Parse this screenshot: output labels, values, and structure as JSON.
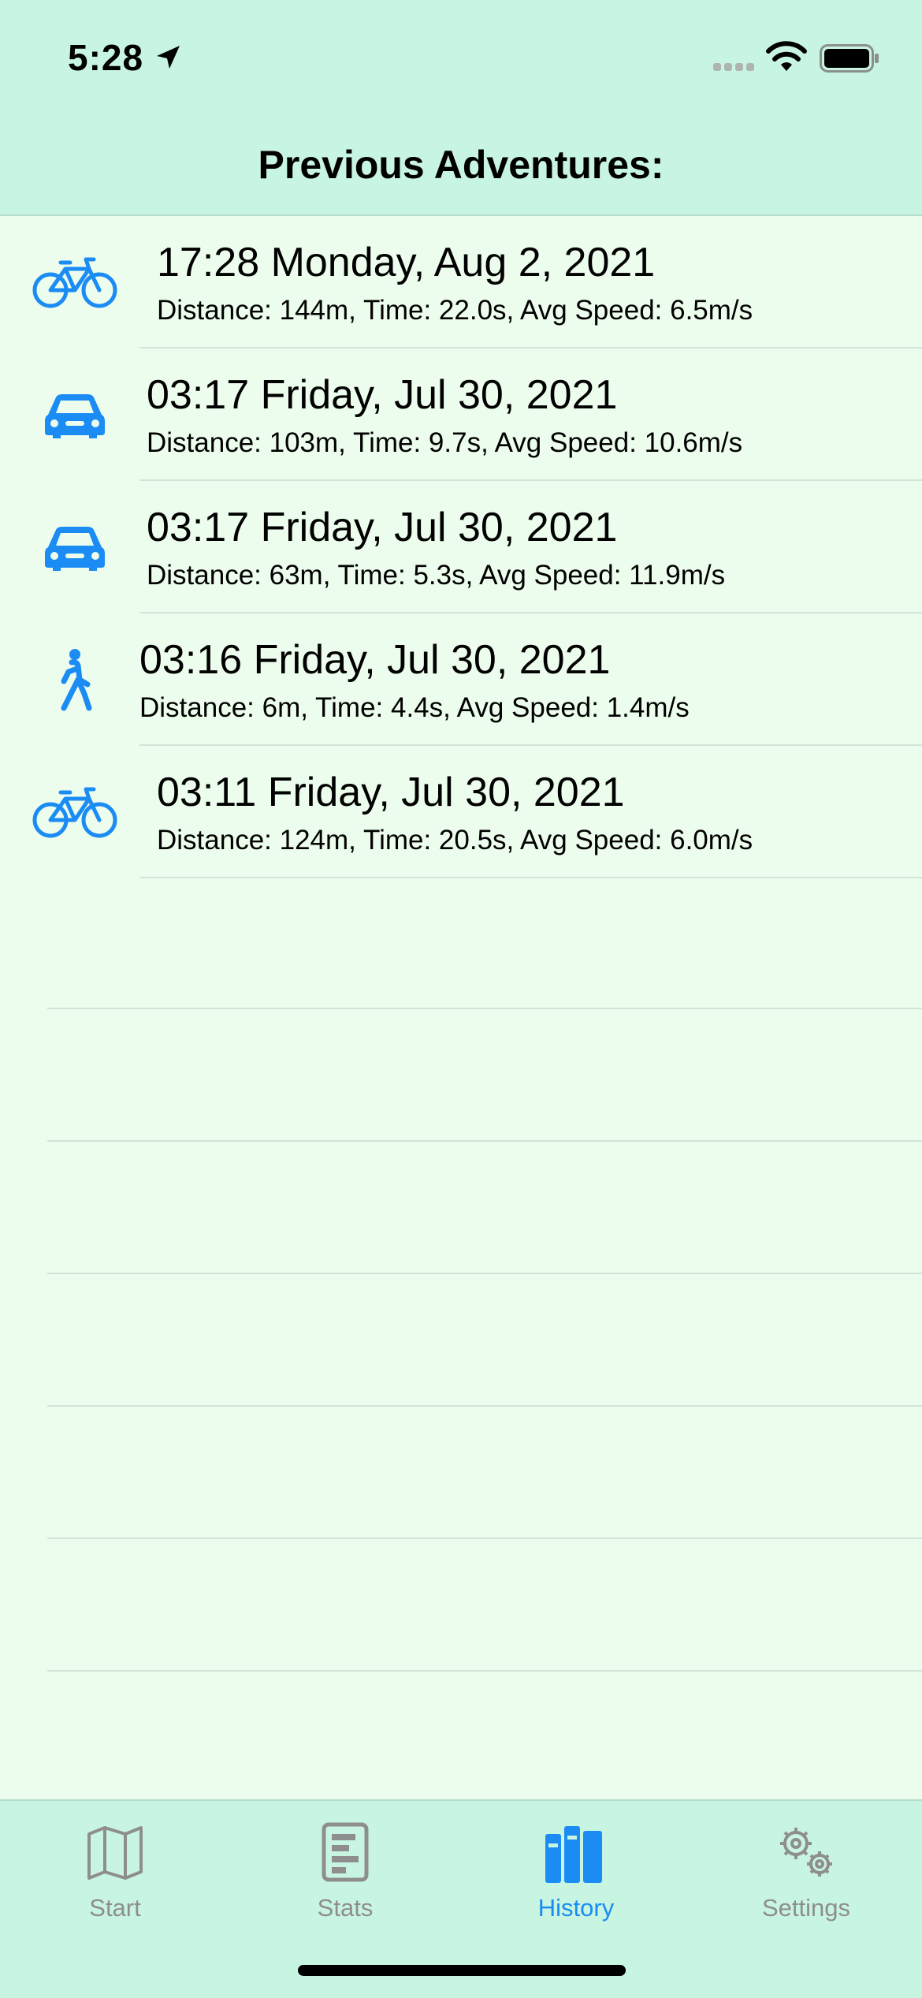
{
  "status_bar": {
    "time": "5:28",
    "icons": [
      "location-arrow-icon",
      "signal-icon",
      "wifi-icon",
      "battery-icon"
    ]
  },
  "nav": {
    "title": "Previous Adventures:"
  },
  "adventures": [
    {
      "mode_icon": "bicycle-icon",
      "title": "17:28 Monday, Aug 2, 2021",
      "details": "Distance: 144m, Time: 22.0s, Avg Speed: 6.5m/s"
    },
    {
      "mode_icon": "car-icon",
      "title": "03:17 Friday, Jul 30, 2021",
      "details": "Distance: 103m, Time: 9.7s, Avg Speed: 10.6m/s"
    },
    {
      "mode_icon": "car-icon",
      "title": "03:17 Friday, Jul 30, 2021",
      "details": "Distance: 63m, Time: 5.3s, Avg Speed: 11.9m/s"
    },
    {
      "mode_icon": "walking-icon",
      "title": "03:16 Friday, Jul 30, 2021",
      "details": "Distance: 6m, Time: 4.4s, Avg Speed: 1.4m/s"
    },
    {
      "mode_icon": "bicycle-icon",
      "title": "03:11 Friday, Jul 30, 2021",
      "details": "Distance: 124m, Time: 20.5s, Avg Speed: 6.0m/s"
    }
  ],
  "tabs": [
    {
      "label": "Start",
      "icon": "map-icon",
      "active": false
    },
    {
      "label": "Stats",
      "icon": "stats-document-icon",
      "active": false
    },
    {
      "label": "History",
      "icon": "books-icon",
      "active": true
    },
    {
      "label": "Settings",
      "icon": "gears-icon",
      "active": false
    }
  ],
  "colors": {
    "accent": "#1a8cf4",
    "bar_background": "#c8f5e2",
    "list_background": "#edfded",
    "inactive_tab": "#8e8e8e"
  }
}
